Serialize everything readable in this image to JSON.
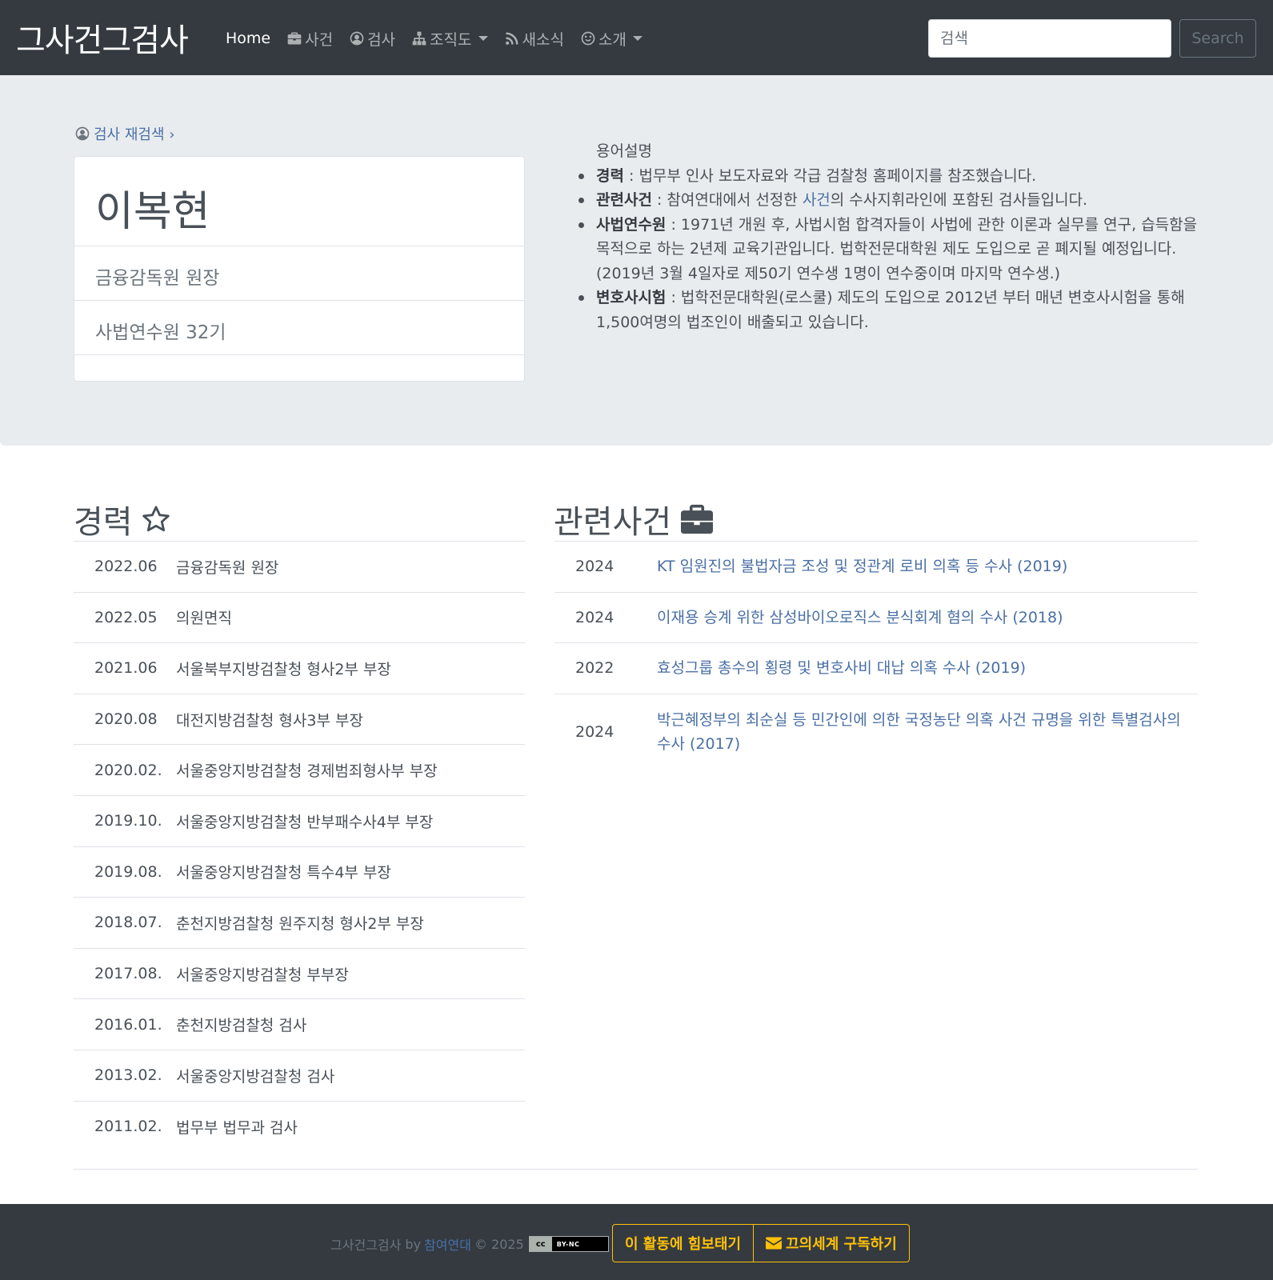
{
  "nav": {
    "brand": "그사건그검사",
    "items": [
      {
        "label": "Home",
        "icon": ""
      },
      {
        "label": "사건",
        "icon": "briefcase-icon"
      },
      {
        "label": "검사",
        "icon": "user-circle-icon"
      },
      {
        "label": "조직도",
        "icon": "sitemap-icon"
      },
      {
        "label": "새소식",
        "icon": "rss-icon"
      },
      {
        "label": "소개",
        "icon": "smile-icon"
      }
    ],
    "search_placeholder": "검색",
    "search_button": "Search"
  },
  "profile": {
    "research_link": "검사 재검색 ›",
    "name": "이복현",
    "position": "금융감독원 원장",
    "training": "사법연수원 32기"
  },
  "glossary": {
    "title": "용어설명",
    "items": [
      {
        "term": "경력",
        "desc": " : 법무부 인사 보도자료와 각급 검찰청 홈페이지를 참조했습니다."
      },
      {
        "term": "관련사건",
        "desc_pre": " : 참여연대에서 선정한 ",
        "link": "사건",
        "desc_post": "의 수사지휘라인에 포함된 검사들입니다."
      },
      {
        "term": "사법연수원",
        "desc": " : 1971년 개원 후, 사법시험 합격자들이 사법에 관한 이론과 실무를 연구, 습득함을 목적으로 하는 2년제 교육기관입니다. 법학전문대학원 제도 도입으로 곧 폐지될 예정입니다. (2019년 3월 4일자로 제50기 연수생 1명이 연수중이며 마지막 연수생.)"
      },
      {
        "term": "변호사시험",
        "desc": " : 법학전문대학원(로스쿨) 제도의 도입으로 2012년 부터 매년 변호사시험을 통해 1,500여명의 법조인이 배출되고 있습니다."
      }
    ]
  },
  "career": {
    "title": "경력",
    "icon": "star-icon",
    "rows": [
      {
        "date": "2022.06",
        "desc": "금융감독원 원장"
      },
      {
        "date": "2022.05",
        "desc": "의원면직"
      },
      {
        "date": "2021.06",
        "desc": "서울북부지방검찰청 형사2부 부장"
      },
      {
        "date": "2020.08",
        "desc": "대전지방검찰청 형사3부 부장"
      },
      {
        "date": "2020.02.",
        "desc": "서울중앙지방검찰청 경제범죄형사부 부장"
      },
      {
        "date": "2019.10.",
        "desc": "서울중앙지방검찰청 반부패수사4부 부장"
      },
      {
        "date": "2019.08.",
        "desc": "서울중앙지방검찰청 특수4부 부장"
      },
      {
        "date": "2018.07.",
        "desc": "춘천지방검찰청 원주지청 형사2부 부장"
      },
      {
        "date": "2017.08.",
        "desc": "서울중앙지방검찰청 부부장"
      },
      {
        "date": "2016.01.",
        "desc": "춘천지방검찰청 검사"
      },
      {
        "date": "2013.02.",
        "desc": "서울중앙지방검찰청 검사"
      },
      {
        "date": "2011.02.",
        "desc": "법무부 법무과 검사"
      }
    ]
  },
  "cases": {
    "title": "관련사건",
    "icon": "briefcase-icon",
    "rows": [
      {
        "year": "2024",
        "title": "KT 임원진의 불법자금 조성 및 정관계 로비 의혹 등 수사 (2019)"
      },
      {
        "year": "2024",
        "title": "이재용 승계 위한 삼성바이오로직스 분식회계 혐의 수사 (2018)"
      },
      {
        "year": "2022",
        "title": "효성그룹 총수의 횡령 및 변호사비 대납 의혹 수사 (2019)"
      },
      {
        "year": "2024",
        "title": "박근혜정부의 최순실 등 민간인에 의한 국정농단 의혹 사건 규명을 위한 특별검사의 수사 (2017)"
      }
    ]
  },
  "footer": {
    "site": "그사건그검사",
    "by": "by",
    "org": "참여연대",
    "copyright": "© 2025",
    "license_left": "cc",
    "license_right": "BY-NC",
    "support_button": "이 활동에 힘보태기",
    "subscribe_button": "끄의세계 구독하기"
  }
}
